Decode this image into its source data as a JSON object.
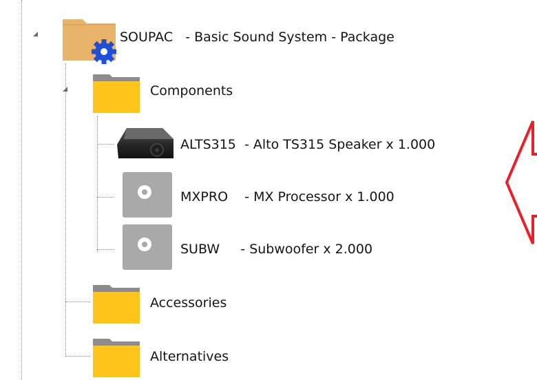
{
  "tree": {
    "package": {
      "label": "SOUPAC   - Basic Sound System - Package",
      "icon": "package-folder-gear-icon"
    },
    "components_folder": {
      "label": "Components",
      "icon": "folder-icon"
    },
    "components": [
      {
        "label": "ALTS315  - Alto TS315 Speaker x 1.000",
        "icon": "speaker-image-icon"
      },
      {
        "label": "MXPRO    - MX Processor x 1.000",
        "icon": "generic-item-icon"
      },
      {
        "label": "SUBW     - Subwoofer x 2.000",
        "icon": "generic-item-icon"
      }
    ],
    "accessories_folder": {
      "label": "Accessories",
      "icon": "folder-icon"
    },
    "alternatives_folder": {
      "label": "Alternatives",
      "icon": "folder-icon"
    }
  },
  "colors": {
    "folder_yellow": "#FFC51A",
    "folder_gray_tab": "#8C8C8C",
    "package_folder": "#E8B46A",
    "gear_blue": "#1F4FD8",
    "arrow_red": "#E8202A",
    "generic_icon_gray": "#A9A9A9"
  }
}
